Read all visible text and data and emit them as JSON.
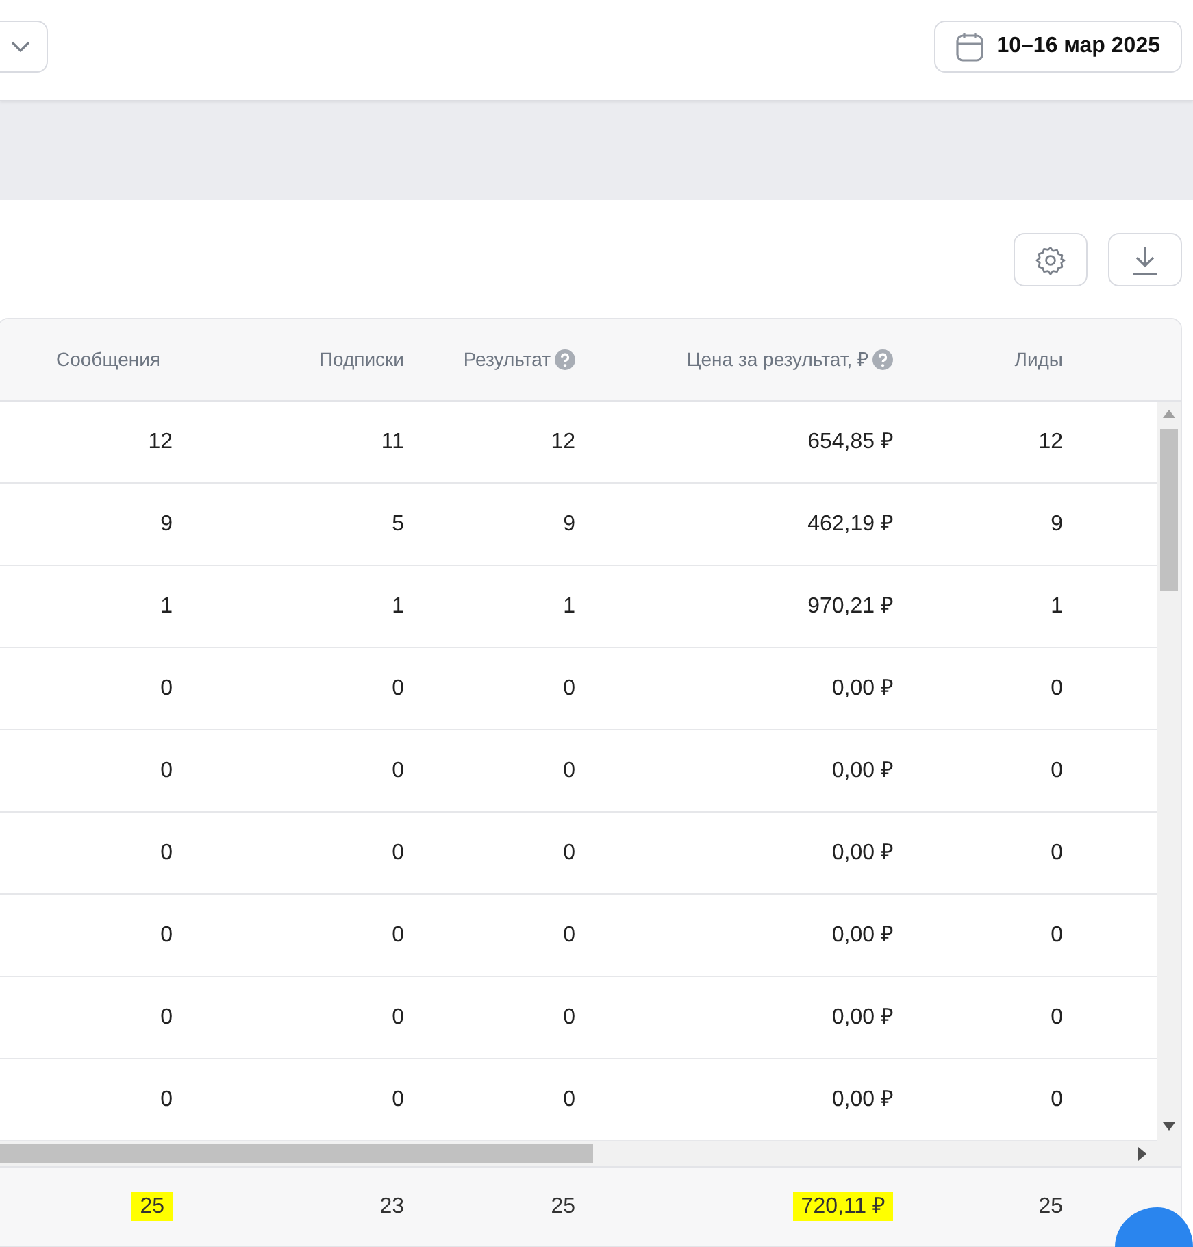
{
  "header": {
    "date_range": "10–16 мар 2025"
  },
  "table": {
    "columns": [
      {
        "label": "Сообщения",
        "help": false
      },
      {
        "label": "Подписки",
        "help": false
      },
      {
        "label": "Результат",
        "help": true
      },
      {
        "label": "Цена за результат, ₽",
        "help": true
      },
      {
        "label": "Лиды",
        "help": false
      }
    ],
    "rows": [
      [
        "12",
        "11",
        "12",
        "654,85 ₽",
        "12"
      ],
      [
        "9",
        "5",
        "9",
        "462,19 ₽",
        "9"
      ],
      [
        "1",
        "1",
        "1",
        "970,21 ₽",
        "1"
      ],
      [
        "0",
        "0",
        "0",
        "0,00 ₽",
        "0"
      ],
      [
        "0",
        "0",
        "0",
        "0,00 ₽",
        "0"
      ],
      [
        "0",
        "0",
        "0",
        "0,00 ₽",
        "0"
      ],
      [
        "0",
        "0",
        "0",
        "0,00 ₽",
        "0"
      ],
      [
        "0",
        "0",
        "0",
        "0,00 ₽",
        "0"
      ],
      [
        "0",
        "0",
        "0",
        "0,00 ₽",
        "0"
      ]
    ],
    "totals": [
      {
        "value": "25",
        "highlighted": true
      },
      {
        "value": "23",
        "highlighted": false
      },
      {
        "value": "25",
        "highlighted": false
      },
      {
        "value": "720,11 ₽",
        "highlighted": true
      },
      {
        "value": "25",
        "highlighted": false
      }
    ]
  }
}
